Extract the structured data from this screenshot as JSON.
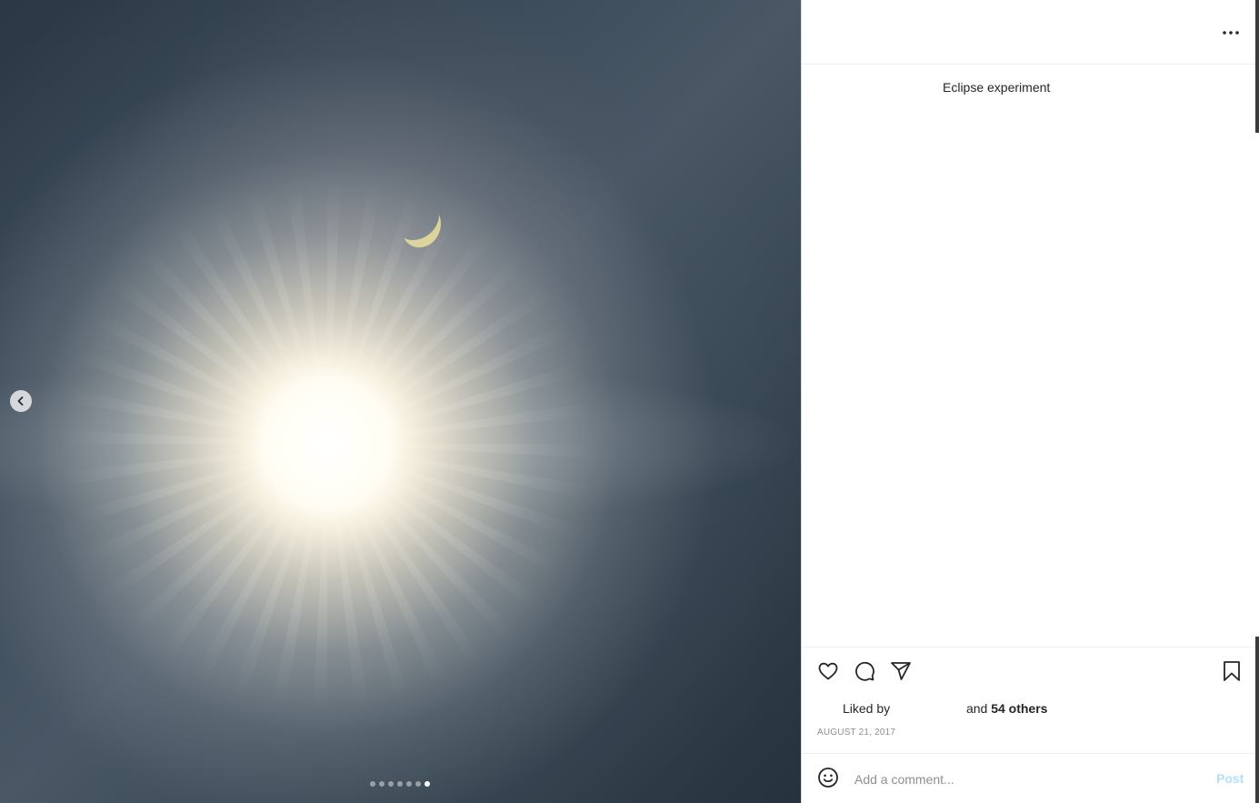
{
  "post": {
    "username": "",
    "caption": "Eclipse experiment",
    "liked_prefix": "Liked by",
    "liked_suffix_and": "and",
    "liked_others": "54 others",
    "date": "AUGUST 21, 2017"
  },
  "carousel": {
    "slide_count": 7,
    "active_index": 6
  },
  "comment": {
    "placeholder": "Add a comment...",
    "post_label": "Post"
  },
  "icons": {
    "more": "more-horizontal-icon",
    "like": "heart-icon",
    "comment": "comment-bubble-icon",
    "share": "paper-plane-icon",
    "save": "bookmark-icon",
    "emoji": "smiley-icon",
    "prev": "chevron-left-icon"
  },
  "colors": {
    "post_button": "#b2dffc",
    "date_text": "#8e8e8e"
  }
}
